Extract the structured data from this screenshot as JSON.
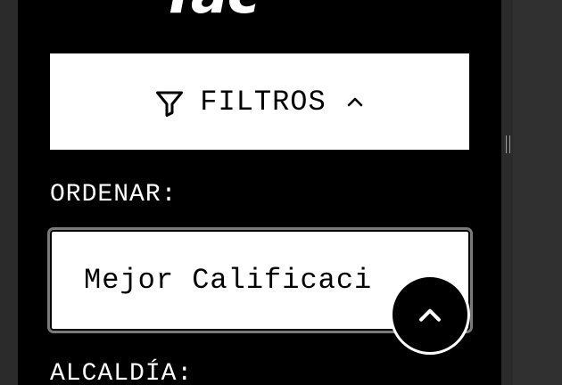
{
  "logo": {
    "text": "Tac"
  },
  "filters": {
    "label": "FILTROS",
    "icon": "funnel-icon",
    "toggle_icon": "chevron-up-icon"
  },
  "sort": {
    "label": "ORDENAR:",
    "selected": "Mejor Calificaci"
  },
  "district": {
    "label": "ALCALDÍA:"
  },
  "scroll_top": {
    "icon": "chevron-up-icon"
  },
  "colors": {
    "panel": "#000000",
    "field": "#ffffff",
    "text_on_dark": "#ffffff"
  }
}
